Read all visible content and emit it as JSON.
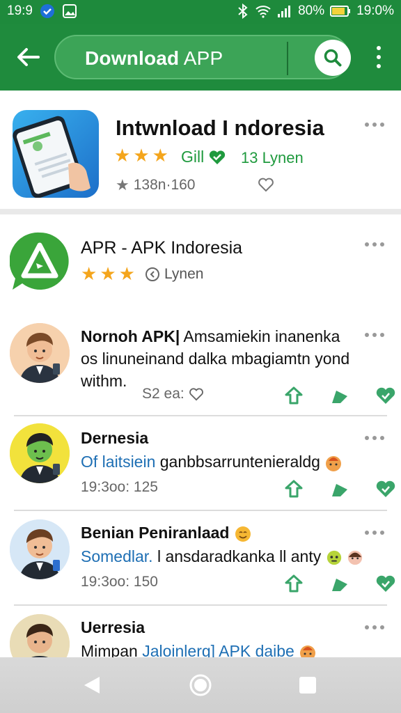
{
  "status_bar": {
    "time_left": "19:9",
    "battery": "80%",
    "time_right": "19:0%"
  },
  "app_bar": {
    "title_bold": "Download",
    "title_rest": " APP"
  },
  "featured": {
    "name": "Intwnload I ndoresia",
    "rating_stars": 3,
    "developer": "Gill",
    "count": "13 Lynen",
    "stats": "138n·160"
  },
  "apr": {
    "name": "APR - APK Indoresia",
    "rating_stars": 3,
    "sub": "Lynen"
  },
  "comments": [
    {
      "author": "Nornoh APK|",
      "line1_rest": " Amsamiekin inanenka",
      "line2": "os linuneinand dalka mbagiamtn yond",
      "line3": "withm.",
      "meta": "S2 ea:"
    },
    {
      "author": "Dernesia",
      "line_blue": "Of laitsiein",
      "line_rest": " ganbbsarruntenieraldg",
      "time": "19:3oo: 125"
    },
    {
      "author": "Benian Peniranlaad",
      "line_blue": "Somedlar.",
      "line_rest": " l ansdaradkanka ll anty",
      "time": "19:3oo: 150"
    },
    {
      "author": "Uerresia",
      "line_plain": "Mimpan ",
      "line_blue": "Jaloinlerg] APK daibe"
    }
  ],
  "colors": {
    "green_primary": "#1f8b3d",
    "green_accent": "#1f9a3e",
    "star": "#f4a51c",
    "blue_text": "#1e6fb4",
    "action_icon": "#3aa56a"
  }
}
